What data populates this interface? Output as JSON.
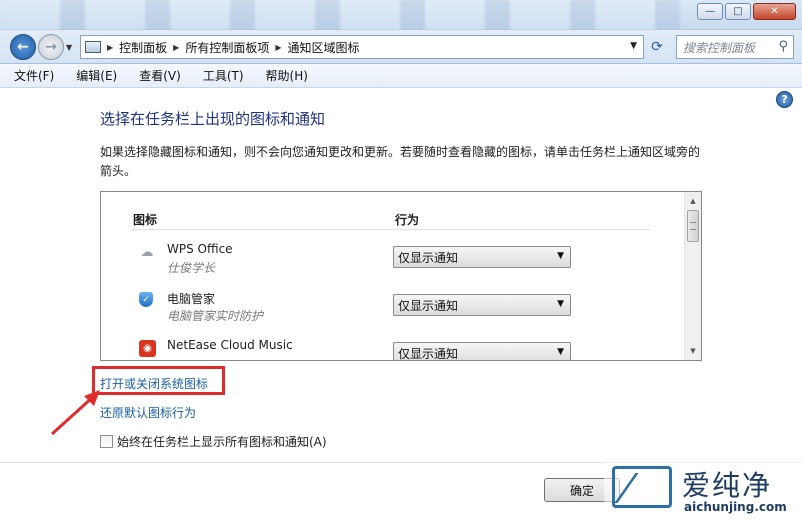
{
  "window": {
    "minimize_glyph": "—",
    "maximize_glyph": "□",
    "close_glyph": "✕"
  },
  "address": {
    "breadcrumbs": [
      "控制面板",
      "所有控制面板项",
      "通知区域图标"
    ],
    "search_placeholder": "搜索控制面板"
  },
  "menu": {
    "items": [
      "文件(F)",
      "编辑(E)",
      "查看(V)",
      "工具(T)",
      "帮助(H)"
    ]
  },
  "main": {
    "help_glyph": "?",
    "title": "选择在任务栏上出现的图标和通知",
    "description": "如果选择隐藏图标和通知，则不会向您通知更改和更新。若要随时查看隐藏的图标，请单击任务栏上通知区域旁的箭头。",
    "columns": {
      "icon": "图标",
      "behavior": "行为"
    },
    "rows": [
      {
        "name": "WPS Office",
        "desc": "仕俊学长",
        "behavior": "仅显示通知",
        "icon": "wps-cloud-icon"
      },
      {
        "name": "电脑管家",
        "desc": "电脑管家实时防护",
        "behavior": "仅显示通知",
        "icon": "shield-icon"
      },
      {
        "name": "NetEase Cloud Music",
        "desc": "",
        "behavior": "仅显示通知",
        "icon": "netease-music-icon"
      }
    ],
    "links": {
      "system_icons": "打开或关闭系统图标",
      "restore": "还原默认图标行为"
    },
    "always_show_label": "始终在任务栏上显示所有图标和通知(A)",
    "ok_label": "确定"
  },
  "watermark": {
    "text": "爱纯净",
    "url": "aichunjing.com"
  },
  "colors": {
    "title_blue": "#1e3287",
    "link_blue": "#1a5fa8",
    "highlight_red": "#e02b2b"
  }
}
